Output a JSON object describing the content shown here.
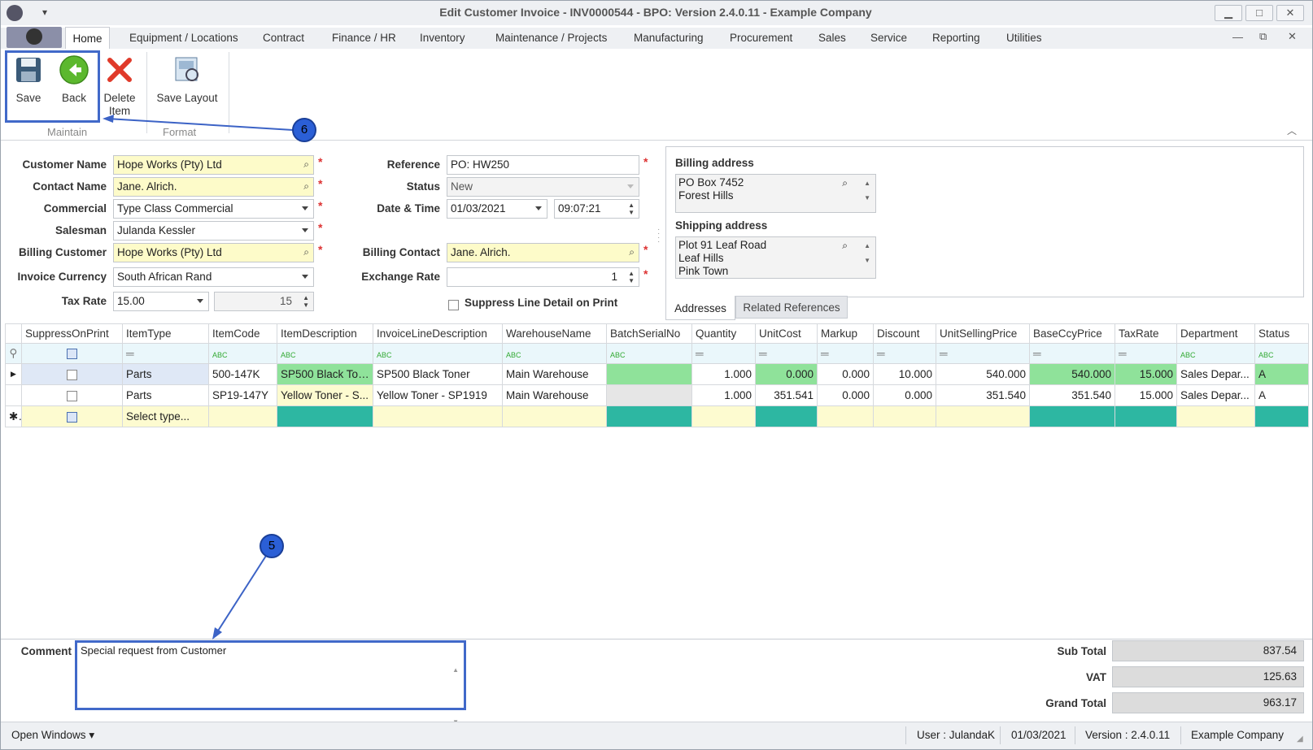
{
  "window": {
    "title": "Edit Customer Invoice - INV0000544 - BPO: Version 2.4.0.11 - Example Company"
  },
  "menu": {
    "tabs": [
      "Home",
      "Equipment / Locations",
      "Contract",
      "Finance / HR",
      "Inventory",
      "Maintenance / Projects",
      "Manufacturing",
      "Procurement",
      "Sales",
      "Service",
      "Reporting",
      "Utilities"
    ]
  },
  "ribbon": {
    "save": "Save",
    "back": "Back",
    "delete": "Delete Item",
    "save_layout": "Save Layout",
    "group_maintain": "Maintain",
    "group_format": "Format"
  },
  "form": {
    "customer_name_label": "Customer Name",
    "customer_name": "Hope Works (Pty) Ltd",
    "contact_name_label": "Contact Name",
    "contact_name": "Jane. Alrich.",
    "commercial_label": "Commercial",
    "commercial": "Type Class Commercial",
    "salesman_label": "Salesman",
    "salesman": "Julanda Kessler",
    "billing_customer_label": "Billing Customer",
    "billing_customer": "Hope Works (Pty) Ltd",
    "invoice_currency_label": "Invoice Currency",
    "invoice_currency": "South African Rand",
    "tax_rate_label": "Tax Rate",
    "tax_rate": "15.00",
    "tax_rate_value": "15",
    "reference_label": "Reference",
    "reference": "PO: HW250",
    "status_label": "Status",
    "status": "New",
    "date_time_label": "Date & Time",
    "date": "01/03/2021",
    "time": "09:07:21",
    "billing_contact_label": "Billing Contact",
    "billing_contact": "Jane. Alrich.",
    "exchange_rate_label": "Exchange Rate",
    "exchange_rate": "1",
    "suppress_label": "Suppress Line Detail on Print"
  },
  "addresses": {
    "billing_title": "Billing address",
    "billing_lines": [
      "PO Box 7452",
      "Forest Hills"
    ],
    "shipping_title": "Shipping address",
    "shipping_lines": [
      "Plot 91 Leaf Road",
      "Leaf Hills",
      "Pink Town"
    ],
    "tab_addresses": "Addresses",
    "tab_related": "Related References"
  },
  "grid": {
    "columns": [
      "SuppressOnPrint",
      "ItemType",
      "ItemCode",
      "ItemDescription",
      "InvoiceLineDescription",
      "WarehouseName",
      "BatchSerialNo",
      "Quantity",
      "UnitCost",
      "Markup",
      "Discount",
      "UnitSellingPrice",
      "BaseCcyPrice",
      "TaxRate",
      "Department",
      "Status"
    ],
    "rows": [
      {
        "type": "Parts",
        "code": "500-147K",
        "desc": "SP500 Black Ton...",
        "line": "SP500 Black Toner",
        "wh": "Main Warehouse",
        "batch": "",
        "qty": "1.000",
        "cost": "0.000",
        "markup": "0.000",
        "disc": "10.000",
        "usp": "540.000",
        "base": "540.000",
        "tax": "15.000",
        "dept": "Sales Depar...",
        "status": "A"
      },
      {
        "type": "Parts",
        "code": "SP19-147Y",
        "desc": "Yellow Toner - S...",
        "line": "Yellow Toner - SP1919",
        "wh": "Main Warehouse",
        "batch": "",
        "qty": "1.000",
        "cost": "351.541",
        "markup": "0.000",
        "disc": "0.000",
        "usp": "351.540",
        "base": "351.540",
        "tax": "15.000",
        "dept": "Sales Depar...",
        "status": "A"
      }
    ],
    "new_row": "Select type..."
  },
  "footer": {
    "comment_label": "Comment",
    "comment": "Special request from Customer",
    "subtotal_label": "Sub Total",
    "subtotal": "837.54",
    "vat_label": "VAT",
    "vat": "125.63",
    "grand_total_label": "Grand Total",
    "grand_total": "963.17"
  },
  "status": {
    "open_windows": "Open Windows",
    "user": "User : JulandaK",
    "date": "01/03/2021",
    "version": "Version : 2.4.0.11",
    "company": "Example Company"
  },
  "callouts": {
    "c5": "5",
    "c6": "6"
  }
}
